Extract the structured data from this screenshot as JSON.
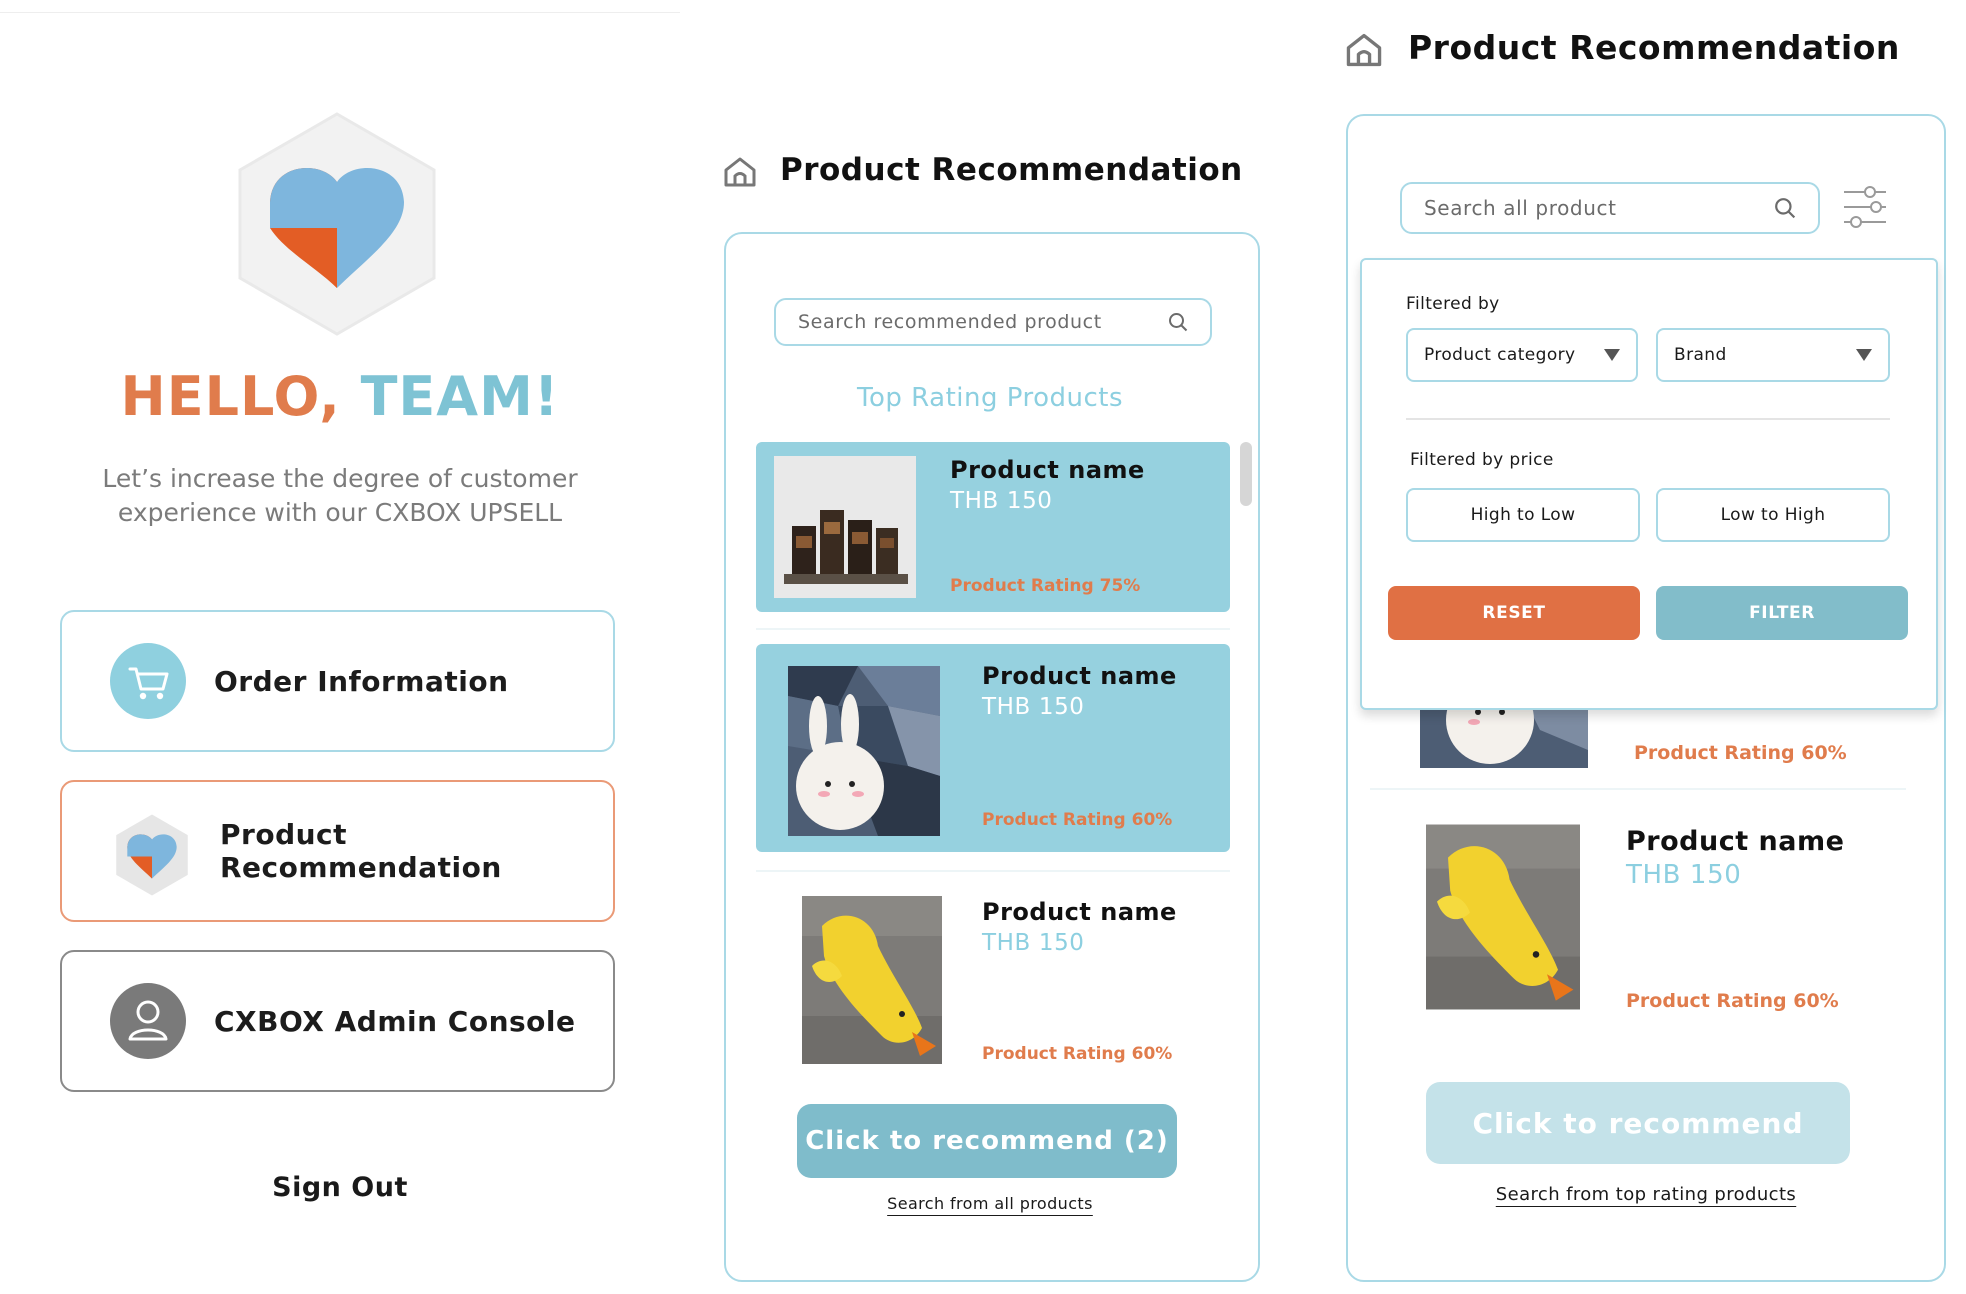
{
  "home": {
    "greeting_part1": "HELLO,",
    "greeting_part2": "TEAM!",
    "subtitle_line1": "Let’s increase the degree of customer",
    "subtitle_line2": "experience with our CXBOX UPSELL",
    "menu": {
      "order_info": "Order Information",
      "product_recommendation": "Product Recommendation",
      "admin_console": "CXBOX Admin Console"
    },
    "sign_out": "Sign Out"
  },
  "screen2": {
    "title": "Product Recommendation",
    "search_placeholder": "Search recommended product",
    "section_title": "Top Rating Products",
    "products": [
      {
        "name": "Product name",
        "price": "THB 150",
        "rating": "Product Rating 75%",
        "selected": true,
        "image": "candle-holders"
      },
      {
        "name": "Product name",
        "price": "THB 150",
        "rating": "Product Rating 60%",
        "selected": true,
        "image": "bunny-toy"
      },
      {
        "name": "Product name",
        "price": "THB 150",
        "rating": "Product Rating 60%",
        "selected": false,
        "image": "duck-toy"
      }
    ],
    "recommend_button": "Click to recommend (2)",
    "footer_link": "Search from all products"
  },
  "screen3": {
    "title": "Product Recommendation",
    "search_placeholder": "Search all product",
    "filter": {
      "filtered_by_label": "Filtered by",
      "category_select": "Product category",
      "brand_select": "Brand",
      "price_label": "Filtered by price",
      "high_to_low": "High to Low",
      "low_to_high": "Low to High",
      "reset": "RESET",
      "filter": "FILTER"
    },
    "products": [
      {
        "rating": "Product Rating 60%",
        "image": "bunny-toy"
      },
      {
        "name": "Product name",
        "price": "THB 150",
        "rating": "Product Rating 60%",
        "image": "duck-toy"
      }
    ],
    "recommend_button": "Click to recommend",
    "footer_link": "Search from top rating products"
  },
  "colors": {
    "accent_orange": "#e07c4c",
    "accent_blue": "#8ccfe0",
    "selected_card": "#96d1df",
    "button_teal": "#7fbccb",
    "button_disabled": "#c4e2e9"
  }
}
